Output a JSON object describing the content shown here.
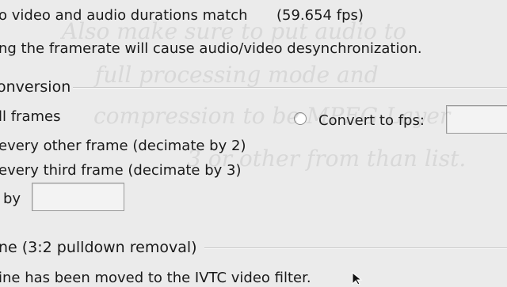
{
  "info": {
    "durations_match": "o video and audio durations match",
    "fps_readout": "(59.654 fps)",
    "desync_warning": "ng the framerate will cause audio/video desynchronization."
  },
  "conversion": {
    "group_label": "onversion",
    "all_frames": "ll frames",
    "every_other": "every other frame (decimate by 2)",
    "every_third": "every third frame (decimate by 3)",
    "by_label": "by",
    "by_value": "",
    "convert_to_fps_label": "Convert to fps:",
    "convert_to_fps_value": ""
  },
  "ivtc": {
    "group_label": "ne (3:2 pulldown removal)",
    "moved_notice": "ine has been moved to the IVTC video filter."
  },
  "watermark": {
    "line1": "Also make sure to put audio to",
    "line2": "full processing mode and",
    "line3": "compression to be MPEG-Layer",
    "line4": "3 or other from than list."
  },
  "icons": {
    "cursor": "mouse-cursor-icon",
    "radio": "radio-button-icon"
  }
}
